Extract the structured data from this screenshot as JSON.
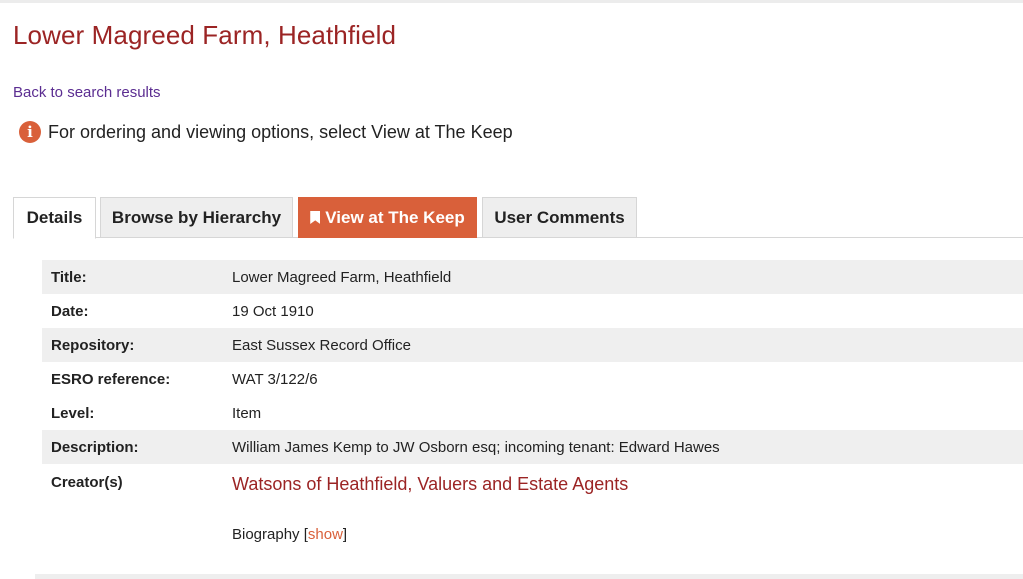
{
  "page": {
    "title": "Lower Magreed Farm, Heathfield",
    "back_link": "Back to search results",
    "notice": "For ordering and viewing options, select View at The Keep",
    "notice_icon": "info-icon"
  },
  "tabs": [
    {
      "label": "Details",
      "active": true
    },
    {
      "label": "Browse by Hierarchy",
      "active": false
    },
    {
      "label": "View at The Keep",
      "active": false,
      "icon": "bookmark-icon"
    },
    {
      "label": "User Comments",
      "active": false
    }
  ],
  "details": {
    "title": {
      "label": "Title:",
      "value": "Lower Magreed Farm, Heathfield"
    },
    "date": {
      "label": "Date:",
      "value": "19 Oct 1910"
    },
    "repository": {
      "label": "Repository:",
      "value": "East Sussex Record Office"
    },
    "reference": {
      "label": "ESRO reference:",
      "value": "WAT 3/122/6"
    },
    "level": {
      "label": "Level:",
      "value": "Item"
    },
    "description": {
      "label": "Description:",
      "value": "William James Kemp to JW Osborn esq; incoming tenant: Edward Hawes"
    },
    "creators": {
      "label": "Creator(s)",
      "value": "Watsons of Heathfield, Valuers and Estate Agents",
      "biography_label": "Biography",
      "bracket_open": "[",
      "show_label": "show",
      "bracket_close": "]"
    }
  },
  "colors": {
    "title_red": "#9b2424",
    "accent_orange": "#d9603a",
    "link_purple": "#5b2d91",
    "row_shade": "#efefef"
  }
}
